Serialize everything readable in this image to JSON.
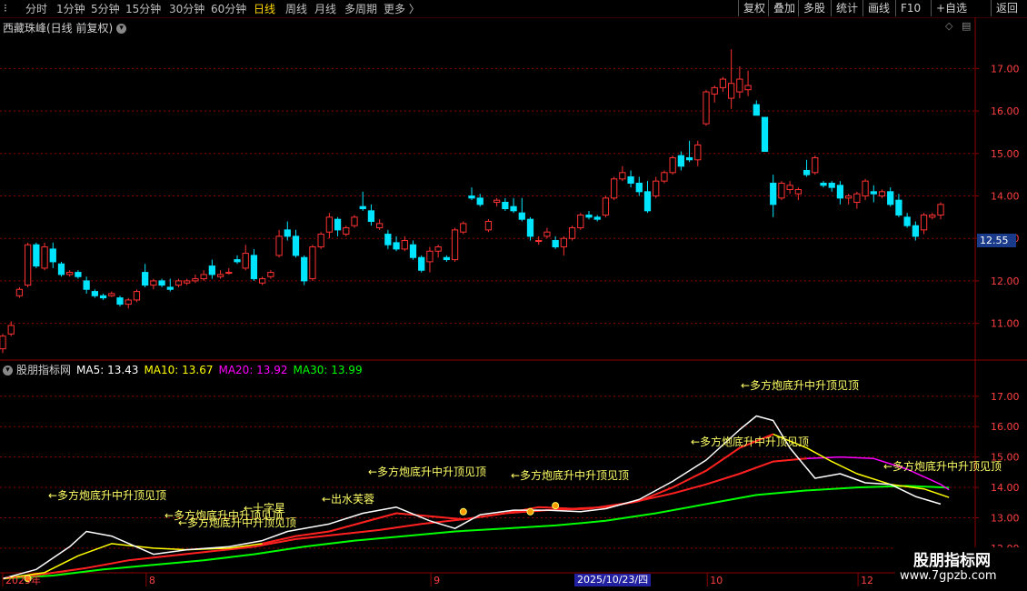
{
  "period_tabs": [
    "分时",
    "1分钟",
    "5分钟",
    "15分钟",
    "30分钟",
    "60分钟",
    "日线",
    "周线",
    "月线",
    "多周期",
    "更多 〉"
  ],
  "active_tab": "日线",
  "toolbar": [
    "复权",
    "叠加",
    "多股",
    "统计",
    "画线",
    "F10",
    "+自选",
    "返回"
  ],
  "stock_title": "西藏珠峰(日线 前复权)",
  "indicator": {
    "name": "股朋指标网",
    "ma5_label": "MA5: 13.43",
    "ma10_label": "MA10: 13.67",
    "ma20_label": "MA20: 13.92",
    "ma30_label": "MA30: 13.99",
    "ma5_color": "#ffffff",
    "ma10_color": "#ffff00",
    "ma20_color": "#ff00ff",
    "ma30_color": "#00ff00"
  },
  "current_price_tag": "12.55",
  "price_axis": [
    "17.00",
    "16.00",
    "15.00",
    "14.00",
    "13.00",
    "12.00",
    "11.00"
  ],
  "indicator_axis": [
    "17.00",
    "16.00",
    "15.00",
    "14.00",
    "13.00",
    "12.00"
  ],
  "date_axis": [
    "2025年",
    "8",
    "9",
    "10",
    "12"
  ],
  "highlight_date": "2025/10/23/四",
  "annotations": [
    "←多方炮底升中升顶见顶",
    "←多方炮底升中升顶见顶",
    "←十字星",
    "←出水芙蓉",
    "←多方炮底升中升顶见顶",
    "←多方炮底升中升顶见顶",
    "←多方炮底升中升顶见顶",
    "←多方炮底升中升顶见顶",
    "←多方炮底升中升顶见顶",
    "←多方炮底升中升顶见顶"
  ],
  "watermark": {
    "line1": "股朋指标网",
    "line2": "www.7gpzb.com"
  },
  "colors": {
    "up": "#ff3232",
    "down": "#00e5ff",
    "grid": "#8b0000"
  },
  "chart_data": {
    "type": "candlestick",
    "ohlc": [
      [
        10.4,
        10.75,
        10.3,
        10.7
      ],
      [
        10.75,
        11.05,
        10.7,
        10.95
      ],
      [
        11.65,
        11.85,
        11.6,
        11.8
      ],
      [
        11.9,
        12.9,
        11.85,
        12.85
      ],
      [
        12.85,
        12.9,
        12.3,
        12.35
      ],
      [
        12.3,
        12.9,
        12.25,
        12.8
      ],
      [
        12.75,
        12.9,
        12.3,
        12.45
      ],
      [
        12.4,
        12.45,
        12.1,
        12.15
      ],
      [
        12.15,
        12.25,
        12.1,
        12.2
      ],
      [
        12.2,
        12.25,
        12.05,
        12.1
      ],
      [
        12.0,
        12.1,
        11.7,
        11.8
      ],
      [
        11.75,
        11.8,
        11.6,
        11.65
      ],
      [
        11.65,
        11.7,
        11.55,
        11.6
      ],
      [
        11.65,
        11.75,
        11.62,
        11.7
      ],
      [
        11.6,
        11.65,
        11.4,
        11.45
      ],
      [
        11.45,
        11.6,
        11.35,
        11.55
      ],
      [
        11.55,
        11.8,
        11.5,
        11.75
      ],
      [
        12.2,
        12.4,
        11.85,
        11.9
      ],
      [
        11.9,
        12.05,
        11.8,
        12.0
      ],
      [
        12.0,
        12.05,
        11.85,
        11.9
      ],
      [
        11.85,
        12.05,
        11.75,
        11.8
      ],
      [
        11.9,
        12.05,
        11.85,
        12.0
      ],
      [
        11.95,
        12.05,
        11.9,
        12.0
      ],
      [
        12.0,
        12.15,
        11.95,
        12.05
      ],
      [
        12.05,
        12.25,
        12.0,
        12.15
      ],
      [
        12.35,
        12.5,
        12.05,
        12.15
      ],
      [
        12.1,
        12.25,
        12.05,
        12.15
      ],
      [
        12.2,
        12.3,
        12.15,
        12.2
      ],
      [
        12.5,
        12.6,
        12.4,
        12.45
      ],
      [
        12.3,
        12.85,
        12.25,
        12.65
      ],
      [
        12.6,
        12.75,
        12.0,
        12.05
      ],
      [
        11.95,
        12.1,
        11.9,
        12.05
      ],
      [
        12.1,
        12.25,
        12.05,
        12.2
      ],
      [
        12.6,
        13.2,
        12.55,
        13.05
      ],
      [
        13.2,
        13.4,
        12.95,
        13.05
      ],
      [
        13.05,
        13.2,
        12.55,
        12.6
      ],
      [
        12.55,
        12.6,
        11.9,
        12.0
      ],
      [
        12.05,
        12.85,
        12.0,
        12.8
      ],
      [
        12.8,
        13.15,
        12.75,
        13.1
      ],
      [
        13.15,
        13.6,
        13.0,
        13.5
      ],
      [
        13.45,
        13.5,
        13.05,
        13.2
      ],
      [
        13.1,
        13.3,
        13.05,
        13.25
      ],
      [
        13.3,
        13.55,
        13.25,
        13.5
      ],
      [
        13.75,
        14.1,
        13.65,
        13.7
      ],
      [
        13.65,
        13.8,
        13.3,
        13.4
      ],
      [
        13.25,
        13.45,
        13.2,
        13.35
      ],
      [
        13.1,
        13.2,
        12.75,
        12.85
      ],
      [
        12.9,
        13.05,
        12.7,
        12.75
      ],
      [
        12.75,
        13.05,
        12.7,
        12.95
      ],
      [
        12.85,
        12.95,
        12.5,
        12.55
      ],
      [
        12.55,
        12.6,
        12.2,
        12.25
      ],
      [
        12.45,
        12.8,
        12.2,
        12.7
      ],
      [
        12.7,
        12.85,
        12.55,
        12.8
      ],
      [
        12.55,
        12.6,
        12.45,
        12.5
      ],
      [
        12.5,
        13.25,
        12.45,
        13.2
      ],
      [
        13.15,
        13.4,
        13.1,
        13.35
      ],
      [
        14.0,
        14.2,
        13.9,
        13.95
      ],
      [
        13.95,
        14.05,
        13.75,
        13.8
      ],
      [
        13.2,
        13.45,
        13.15,
        13.4
      ],
      [
        13.85,
        13.95,
        13.75,
        13.9
      ],
      [
        13.85,
        13.95,
        13.65,
        13.7
      ],
      [
        13.75,
        13.95,
        13.6,
        13.65
      ],
      [
        13.6,
        13.95,
        13.4,
        13.45
      ],
      [
        13.45,
        13.5,
        12.95,
        13.05
      ],
      [
        12.95,
        13.05,
        12.85,
        12.95
      ],
      [
        13.05,
        13.25,
        13.0,
        13.15
      ],
      [
        12.95,
        13.05,
        12.75,
        12.8
      ],
      [
        12.8,
        13.05,
        12.6,
        13.0
      ],
      [
        13.0,
        13.3,
        12.95,
        13.25
      ],
      [
        13.25,
        13.6,
        13.2,
        13.55
      ],
      [
        13.55,
        13.65,
        13.45,
        13.5
      ],
      [
        13.5,
        13.55,
        13.4,
        13.45
      ],
      [
        13.55,
        14.0,
        13.5,
        13.95
      ],
      [
        13.95,
        14.45,
        13.9,
        14.4
      ],
      [
        14.4,
        14.7,
        14.35,
        14.55
      ],
      [
        14.45,
        14.6,
        14.2,
        14.3
      ],
      [
        14.3,
        14.45,
        14.0,
        14.1
      ],
      [
        14.1,
        14.35,
        13.6,
        13.65
      ],
      [
        14.0,
        14.45,
        13.95,
        14.35
      ],
      [
        14.35,
        14.6,
        14.3,
        14.55
      ],
      [
        14.55,
        14.95,
        14.5,
        14.9
      ],
      [
        14.95,
        15.05,
        14.6,
        14.7
      ],
      [
        14.9,
        15.3,
        14.8,
        14.85
      ],
      [
        14.85,
        15.3,
        14.7,
        15.2
      ],
      [
        15.7,
        16.5,
        15.65,
        16.45
      ],
      [
        16.4,
        16.6,
        16.2,
        16.55
      ],
      [
        16.55,
        16.8,
        16.45,
        16.75
      ],
      [
        16.3,
        17.45,
        16.05,
        16.65
      ],
      [
        16.45,
        17.05,
        16.3,
        16.75
      ],
      [
        16.5,
        16.95,
        16.35,
        16.6
      ],
      [
        16.15,
        16.25,
        15.9,
        15.9
      ],
      [
        15.85,
        15.85,
        15.05,
        15.05
      ],
      [
        14.3,
        14.5,
        13.5,
        13.8
      ],
      [
        13.95,
        14.35,
        13.9,
        14.3
      ],
      [
        14.15,
        14.35,
        14.05,
        14.25
      ],
      [
        14.05,
        14.2,
        13.9,
        14.15
      ],
      [
        14.6,
        14.85,
        14.45,
        14.5
      ],
      [
        14.55,
        14.95,
        14.5,
        14.9
      ],
      [
        14.3,
        14.35,
        14.2,
        14.25
      ],
      [
        14.3,
        14.35,
        14.1,
        14.2
      ],
      [
        14.25,
        14.35,
        13.8,
        13.95
      ],
      [
        13.95,
        14.05,
        13.8,
        14.0
      ],
      [
        13.85,
        14.1,
        13.7,
        14.05
      ],
      [
        14.0,
        14.4,
        13.9,
        14.35
      ],
      [
        14.1,
        14.25,
        13.85,
        14.05
      ],
      [
        14.0,
        14.15,
        13.95,
        14.1
      ],
      [
        14.1,
        14.2,
        13.75,
        13.8
      ],
      [
        13.9,
        14.05,
        13.5,
        13.55
      ],
      [
        13.5,
        13.6,
        13.25,
        13.3
      ],
      [
        13.3,
        13.4,
        12.95,
        13.05
      ],
      [
        13.2,
        13.6,
        13.1,
        13.55
      ],
      [
        13.5,
        13.6,
        13.45,
        13.55
      ],
      [
        13.55,
        13.85,
        13.45,
        13.8
      ]
    ],
    "price_range": [
      10.2,
      17.8
    ],
    "indicator_range": [
      11.25,
      17.95
    ],
    "ma5": [
      [
        0,
        11.0
      ],
      [
        4,
        11.3
      ],
      [
        8,
        12.05
      ],
      [
        10,
        12.55
      ],
      [
        13,
        12.4
      ],
      [
        18,
        11.8
      ],
      [
        22,
        11.95
      ],
      [
        27,
        12.05
      ],
      [
        31,
        12.25
      ],
      [
        34,
        12.55
      ],
      [
        39,
        12.8
      ],
      [
        43,
        13.15
      ],
      [
        47,
        13.35
      ],
      [
        51,
        12.9
      ],
      [
        54,
        12.65
      ],
      [
        57,
        13.1
      ],
      [
        61,
        13.25
      ],
      [
        65,
        13.25
      ],
      [
        69,
        13.2
      ],
      [
        72,
        13.3
      ],
      [
        76,
        13.6
      ],
      [
        80,
        14.2
      ],
      [
        84,
        14.9
      ],
      [
        88,
        15.9
      ],
      [
        90,
        16.35
      ],
      [
        92,
        16.2
      ],
      [
        94,
        15.3
      ],
      [
        97,
        14.3
      ],
      [
        100,
        14.45
      ],
      [
        103,
        14.15
      ],
      [
        106,
        14.1
      ],
      [
        109,
        13.7
      ],
      [
        112,
        13.45
      ]
    ],
    "ma10": [
      [
        0,
        11.0
      ],
      [
        5,
        11.2
      ],
      [
        9,
        11.75
      ],
      [
        13,
        12.15
      ],
      [
        18,
        12.0
      ],
      [
        22,
        11.95
      ],
      [
        27,
        12.0
      ],
      [
        31,
        12.15
      ],
      [
        35,
        12.4
      ],
      [
        39,
        12.55
      ],
      [
        43,
        12.85
      ],
      [
        47,
        13.15
      ],
      [
        51,
        13.05
      ],
      [
        55,
        12.95
      ],
      [
        60,
        13.15
      ],
      [
        64,
        13.35
      ],
      [
        68,
        13.3
      ],
      [
        72,
        13.35
      ],
      [
        76,
        13.55
      ],
      [
        80,
        14.0
      ],
      [
        84,
        14.55
      ],
      [
        88,
        15.3
      ],
      [
        92,
        15.75
      ],
      [
        96,
        15.3
      ],
      [
        99,
        14.85
      ],
      [
        102,
        14.45
      ],
      [
        106,
        14.1
      ],
      [
        110,
        13.95
      ],
      [
        113,
        13.67
      ]
    ],
    "ma20": [
      [
        0,
        11.0
      ],
      [
        5,
        11.15
      ],
      [
        10,
        11.35
      ],
      [
        15,
        11.6
      ],
      [
        20,
        11.75
      ],
      [
        25,
        11.9
      ],
      [
        30,
        12.05
      ],
      [
        35,
        12.3
      ],
      [
        40,
        12.45
      ],
      [
        45,
        12.6
      ],
      [
        50,
        12.8
      ],
      [
        55,
        12.95
      ],
      [
        60,
        13.15
      ],
      [
        65,
        13.25
      ],
      [
        70,
        13.3
      ],
      [
        75,
        13.5
      ],
      [
        80,
        13.8
      ],
      [
        84,
        14.1
      ],
      [
        88,
        14.45
      ],
      [
        92,
        14.85
      ],
      [
        96,
        14.95
      ],
      [
        100,
        15.0
      ],
      [
        104,
        14.95
      ],
      [
        108,
        14.6
      ],
      [
        112,
        14.1
      ],
      [
        113,
        13.92
      ]
    ],
    "ma30": [
      [
        0,
        11.0
      ],
      [
        6,
        11.1
      ],
      [
        12,
        11.3
      ],
      [
        18,
        11.45
      ],
      [
        24,
        11.6
      ],
      [
        30,
        11.8
      ],
      [
        36,
        12.05
      ],
      [
        42,
        12.25
      ],
      [
        48,
        12.4
      ],
      [
        54,
        12.55
      ],
      [
        60,
        12.65
      ],
      [
        66,
        12.75
      ],
      [
        72,
        12.9
      ],
      [
        78,
        13.15
      ],
      [
        84,
        13.45
      ],
      [
        90,
        13.75
      ],
      [
        96,
        13.9
      ],
      [
        102,
        14.0
      ],
      [
        108,
        14.05
      ],
      [
        113,
        13.99
      ]
    ]
  }
}
